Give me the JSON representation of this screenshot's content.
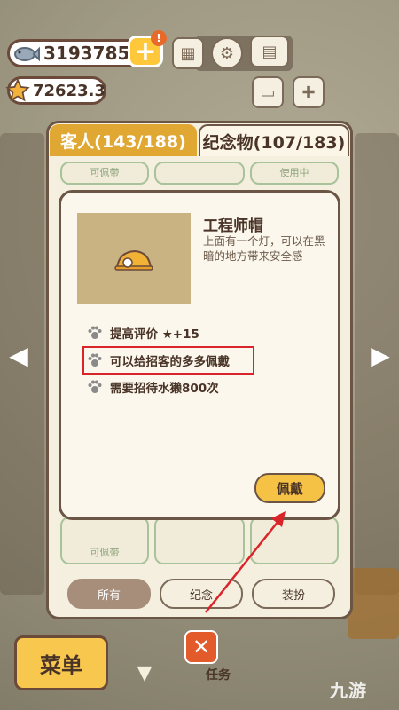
{
  "hud": {
    "fish_count": "3193785",
    "star_count": "72623.3",
    "alert_mark": "!",
    "plus_mark": "+"
  },
  "tabs": {
    "guests": "客人(143/188)",
    "souvenirs": "纪念物(107/183)"
  },
  "grid": {
    "top_row": [
      "可佩带",
      "",
      "使用中"
    ],
    "bottom_row": [
      "可佩带",
      "",
      ""
    ]
  },
  "dialog": {
    "item_name": "工程师帽",
    "item_desc": "上面有一个灯，可以在黑暗的地方带来安全感",
    "effects": [
      "提高评价 ★+15",
      "可以给招客的多多佩戴",
      "需要招待水獭800次"
    ],
    "wear_button": "佩戴"
  },
  "filters": [
    "所有",
    "纪念",
    "装扮"
  ],
  "bottom": {
    "menu_label": "菜单",
    "task_label": "任务"
  },
  "watermark": "九游",
  "colors": {
    "accent_yellow": "#f6c245",
    "tab_active": "#e0a832",
    "highlight_red": "#d9252a"
  }
}
